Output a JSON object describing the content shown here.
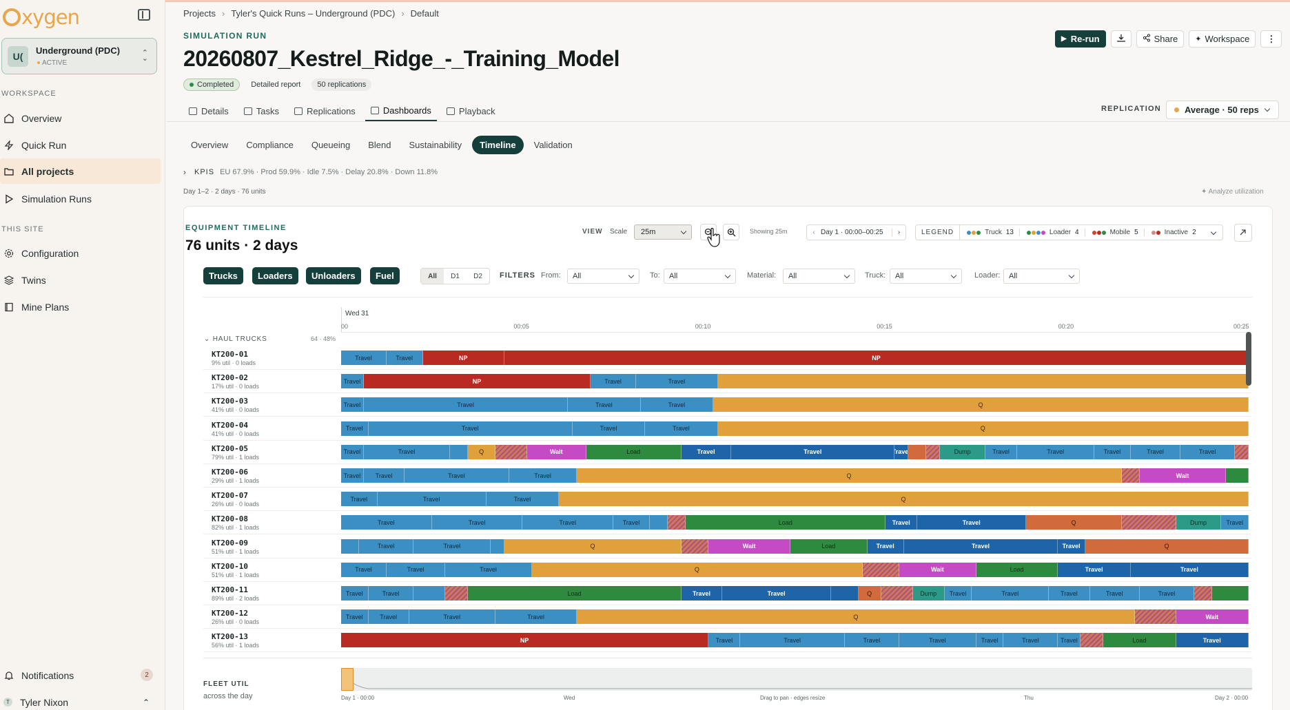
{
  "brand": "Oxygen",
  "site": {
    "avatar": "U(",
    "name": "Underground (PDC)",
    "status": "ACTIVE"
  },
  "sidebar": {
    "section_workspace": "WORKSPACE",
    "items": [
      {
        "label": "Overview",
        "icon": "home-icon"
      },
      {
        "label": "Quick Run",
        "icon": "bolt-icon"
      },
      {
        "label": "All projects",
        "icon": "folder-icon",
        "active": true
      },
      {
        "label": "Simulation Runs",
        "icon": "play-icon"
      }
    ],
    "section_site": "THIS SITE",
    "site_items": [
      {
        "label": "Configuration",
        "icon": "gear-icon"
      },
      {
        "label": "Twins",
        "icon": "layers-icon"
      },
      {
        "label": "Mine Plans",
        "icon": "book-icon"
      }
    ],
    "notifications_label": "Notifications",
    "notifications_count": "2",
    "user_initial": "T",
    "user_name": "Tyler Nixon"
  },
  "breadcrumb": [
    "Projects",
    "Tyler's Quick Runs – Underground (PDC)",
    "Default"
  ],
  "run": {
    "eyebrow": "SIMULATION RUN",
    "title": "20260807_Kestrel_Ridge_-_Training_Model",
    "status": "Completed",
    "report": "Detailed report",
    "replications": "50 replications"
  },
  "actions": {
    "rerun": "Re-run",
    "share": "Share",
    "workspace": "Workspace"
  },
  "tabs": [
    "Details",
    "Tasks",
    "Replications",
    "Dashboards",
    "Playback"
  ],
  "active_tab": "Dashboards",
  "replication": {
    "label": "REPLICATION",
    "value": "Average · 50 reps"
  },
  "subtabs": [
    "Overview",
    "Compliance",
    "Queueing",
    "Blend",
    "Sustainability",
    "Timeline",
    "Validation"
  ],
  "active_subtab": "Timeline",
  "kpis": {
    "label": "KPIS",
    "text": "EU 67.9% · Prod 59.9% · Idle 7.5% · Delay 20.8% · Down 11.8%"
  },
  "range_note": "Day 1–2 · 2 days · 76 units",
  "analyze": "Analyze utilization",
  "timeline": {
    "eyebrow": "EQUIPMENT TIMELINE",
    "title": "76 units · 2 days",
    "view_label": "VIEW",
    "scale_label": "Scale",
    "scale_value": "25m",
    "showing": "Showing 25m",
    "day_range": "Day 1 · 00:00–00:25",
    "legend_label": "LEGEND",
    "legend": [
      {
        "name": "Truck",
        "count": "13",
        "colors": [
          "#3b8fc2",
          "#e0a03b",
          "#2e8a3e"
        ]
      },
      {
        "name": "Loader",
        "count": "4",
        "colors": [
          "#2e8a3e",
          "#e0a03b",
          "#3b8fc2",
          "#c44bc4"
        ]
      },
      {
        "name": "Mobile",
        "count": "5",
        "colors": [
          "#c44b2b",
          "#b82a22",
          "#2e8a3e"
        ]
      },
      {
        "name": "Inactive",
        "count": "2",
        "colors": [
          "#d28a8a",
          "#b82a22"
        ]
      }
    ],
    "filter_pills": [
      "Trucks",
      "Loaders",
      "Unloaders",
      "Fuel"
    ],
    "day_segments": [
      "All",
      "D1",
      "D2"
    ],
    "filters_label": "FILTERS",
    "filters": [
      {
        "label": "From:",
        "value": "All"
      },
      {
        "label": "To:",
        "value": "All"
      },
      {
        "label": "Material:",
        "value": "All"
      },
      {
        "label": "Truck:",
        "value": "All"
      },
      {
        "label": "Loader:",
        "value": "All"
      }
    ],
    "axis_day": "Wed 31",
    "ticks": [
      "00",
      "00:05",
      "00:10",
      "00:15",
      "00:20",
      "00:25"
    ],
    "group_label": "HAUL TRUCKS",
    "group_util": "64 · 48%",
    "rows": [
      {
        "name": "KT200-01",
        "sub": "9% util · 0 loads",
        "segs": [
          [
            "travel",
            0,
            5,
            "Travel"
          ],
          [
            "travel",
            5,
            9,
            "Travel"
          ],
          [
            "np",
            9,
            18,
            "NP"
          ],
          [
            "np",
            18,
            100,
            "NP"
          ]
        ]
      },
      {
        "name": "KT200-02",
        "sub": "17% util · 0 loads",
        "segs": [
          [
            "travel",
            0,
            2.5,
            "Travel"
          ],
          [
            "np",
            2.5,
            27.5,
            "NP"
          ],
          [
            "travel",
            27.5,
            32.5,
            "Travel"
          ],
          [
            "travel",
            32.5,
            41.5,
            "Travel"
          ],
          [
            "q",
            41.5,
            100,
            ""
          ]
        ]
      },
      {
        "name": "KT200-03",
        "sub": "41% util · 0 loads",
        "segs": [
          [
            "travel",
            0,
            2.5,
            "Travel"
          ],
          [
            "travel",
            2.5,
            25,
            "Travel"
          ],
          [
            "travel",
            25,
            33,
            "Travel"
          ],
          [
            "travel",
            33,
            41,
            "Travel"
          ],
          [
            "q",
            41,
            100,
            "Q"
          ]
        ]
      },
      {
        "name": "KT200-04",
        "sub": "41% util · 0 loads",
        "segs": [
          [
            "travel",
            0,
            3,
            "Travel"
          ],
          [
            "travel",
            3,
            25.5,
            "Travel"
          ],
          [
            "travel",
            25.5,
            33.5,
            "Travel"
          ],
          [
            "travel",
            33.5,
            41.5,
            "Travel"
          ],
          [
            "q",
            41.5,
            100,
            "Q"
          ]
        ]
      },
      {
        "name": "KT200-05",
        "sub": "79% util · 1 loads",
        "segs": [
          [
            "travel",
            0,
            2.5,
            "Travel"
          ],
          [
            "travel",
            2.5,
            12,
            "Travel"
          ],
          [
            "travel",
            12,
            14,
            ""
          ],
          [
            "q",
            14,
            17,
            "Q"
          ],
          [
            "hatch",
            17,
            20.5,
            ""
          ],
          [
            "wait",
            20.5,
            27,
            "Wait"
          ],
          [
            "load",
            27,
            37.5,
            "Load"
          ],
          [
            "haul",
            37.5,
            43,
            "Travel"
          ],
          [
            "haul",
            43,
            61,
            "Travel"
          ],
          [
            "haul",
            61,
            62.5,
            "Travel"
          ],
          [
            "orange",
            62.5,
            64.5,
            ""
          ],
          [
            "hatch",
            64.5,
            66,
            ""
          ],
          [
            "dump",
            66,
            71,
            "Dump"
          ],
          [
            "travel",
            71,
            74.5,
            "Travel"
          ],
          [
            "travel",
            74.5,
            83,
            "Travel"
          ],
          [
            "travel",
            83,
            87,
            "Travel"
          ],
          [
            "travel",
            87,
            92.5,
            "Travel"
          ],
          [
            "travel",
            92.5,
            98.5,
            "Travel"
          ],
          [
            "hatch",
            98.5,
            100,
            ""
          ]
        ]
      },
      {
        "name": "KT200-06",
        "sub": "29% util · 1 loads",
        "segs": [
          [
            "travel",
            0,
            2.5,
            "Travel"
          ],
          [
            "travel",
            2.5,
            7,
            "Travel"
          ],
          [
            "travel",
            7,
            18.5,
            "Travel"
          ],
          [
            "travel",
            18.5,
            26,
            "Travel"
          ],
          [
            "q",
            26,
            86,
            "Q"
          ],
          [
            "hatch",
            86,
            88,
            ""
          ],
          [
            "wait",
            88,
            97.5,
            "Wait"
          ],
          [
            "load",
            97.5,
            100,
            ""
          ]
        ]
      },
      {
        "name": "KT200-07",
        "sub": "26% util · 0 loads",
        "segs": [
          [
            "travel",
            0,
            4,
            "Travel"
          ],
          [
            "travel",
            4,
            16,
            "Travel"
          ],
          [
            "travel",
            16,
            24,
            "Travel"
          ],
          [
            "q",
            24,
            100,
            "Q"
          ]
        ]
      },
      {
        "name": "KT200-08",
        "sub": "82% util · 1 loads",
        "segs": [
          [
            "travel",
            0,
            10,
            "Travel"
          ],
          [
            "travel",
            10,
            20,
            "Travel"
          ],
          [
            "travel",
            20,
            30,
            "Travel"
          ],
          [
            "travel",
            30,
            34,
            "Travel"
          ],
          [
            "travel",
            34,
            36,
            ""
          ],
          [
            "hatch",
            36,
            38,
            ""
          ],
          [
            "load",
            38,
            60,
            "Load"
          ],
          [
            "haul",
            60,
            63.5,
            "Travel"
          ],
          [
            "haul",
            63.5,
            75.5,
            "Travel"
          ],
          [
            "orange",
            75.5,
            86,
            "Q"
          ],
          [
            "hatch",
            86,
            92,
            ""
          ],
          [
            "dump",
            92,
            97,
            "Dump"
          ],
          [
            "travel",
            97,
            100,
            "Travel"
          ]
        ]
      },
      {
        "name": "KT200-09",
        "sub": "51% util · 1 loads",
        "segs": [
          [
            "travel",
            0,
            2,
            ""
          ],
          [
            "travel",
            2,
            8,
            "Travel"
          ],
          [
            "travel",
            8,
            16.5,
            "Travel"
          ],
          [
            "travel",
            16.5,
            18,
            ""
          ],
          [
            "q",
            18,
            37.5,
            "Q"
          ],
          [
            "hatch",
            37.5,
            40.5,
            ""
          ],
          [
            "wait",
            40.5,
            49.5,
            "Wait"
          ],
          [
            "load",
            49.5,
            58,
            "Load"
          ],
          [
            "haul",
            58,
            62,
            "Travel"
          ],
          [
            "haul",
            62,
            79,
            "Travel"
          ],
          [
            "haul",
            79,
            82,
            "Travel"
          ],
          [
            "orange",
            82,
            100,
            "Q"
          ]
        ]
      },
      {
        "name": "KT200-10",
        "sub": "51% util · 1 loads",
        "segs": [
          [
            "travel",
            0,
            5,
            "Travel"
          ],
          [
            "travel",
            5,
            11.5,
            "Travel"
          ],
          [
            "travel",
            11.5,
            21,
            "Travel"
          ],
          [
            "q",
            21,
            57.5,
            "Q"
          ],
          [
            "hatch",
            57.5,
            61.5,
            ""
          ],
          [
            "wait",
            61.5,
            70,
            "Wait"
          ],
          [
            "load",
            70,
            79,
            "Load"
          ],
          [
            "haul",
            79,
            87,
            "Travel"
          ],
          [
            "haul",
            87,
            100,
            "Travel"
          ]
        ]
      },
      {
        "name": "KT200-11",
        "sub": "89% util · 2 loads",
        "segs": [
          [
            "travel",
            0,
            3,
            "Travel"
          ],
          [
            "travel",
            3,
            8,
            "Travel"
          ],
          [
            "travel",
            8,
            11.5,
            ""
          ],
          [
            "hatch",
            11.5,
            14,
            ""
          ],
          [
            "load",
            14,
            37.5,
            "Load"
          ],
          [
            "haul",
            37.5,
            42,
            "Travel"
          ],
          [
            "haul",
            42,
            54,
            "Travel"
          ],
          [
            "haul",
            54,
            57,
            ""
          ],
          [
            "orange",
            57,
            59.5,
            "Q"
          ],
          [
            "hatch",
            59.5,
            63,
            ""
          ],
          [
            "dump",
            63,
            66.5,
            "Dump"
          ],
          [
            "travel",
            66.5,
            69.5,
            "Travel"
          ],
          [
            "travel",
            69.5,
            78,
            "Travel"
          ],
          [
            "travel",
            78,
            82.5,
            "Travel"
          ],
          [
            "travel",
            82.5,
            88,
            "Travel"
          ],
          [
            "travel",
            88,
            94,
            "Travel"
          ],
          [
            "hatch",
            94,
            96,
            ""
          ],
          [
            "load",
            96,
            100,
            ""
          ]
        ]
      },
      {
        "name": "KT200-12",
        "sub": "26% util · 0 loads",
        "segs": [
          [
            "travel",
            0,
            3,
            "Travel"
          ],
          [
            "travel",
            3,
            7.5,
            "Travel"
          ],
          [
            "travel",
            7.5,
            17,
            "Travel"
          ],
          [
            "travel",
            17,
            26,
            "Travel"
          ],
          [
            "q",
            26,
            87.5,
            "Q"
          ],
          [
            "hatch",
            87.5,
            92,
            ""
          ],
          [
            "wait",
            92,
            100,
            "Wait"
          ]
        ]
      },
      {
        "name": "KT200-13",
        "sub": "56% util · 1 loads",
        "segs": [
          [
            "np",
            0,
            40.5,
            "NP"
          ],
          [
            "travel",
            40.5,
            44,
            "Travel"
          ],
          [
            "travel",
            44,
            55.5,
            "Travel"
          ],
          [
            "travel",
            55.5,
            61.5,
            "Travel"
          ],
          [
            "travel",
            61.5,
            70,
            "Travel"
          ],
          [
            "travel",
            70,
            73,
            "Travel"
          ],
          [
            "travel",
            73,
            79,
            "Travel"
          ],
          [
            "travel",
            79,
            81.5,
            "Travel"
          ],
          [
            "hatch",
            81.5,
            84,
            ""
          ],
          [
            "load",
            84,
            92,
            "Load"
          ],
          [
            "haul",
            92,
            100,
            "Travel"
          ]
        ]
      }
    ],
    "fleet_label": "FLEET UTIL",
    "fleet_sub": "across the day",
    "fleet_ticks": [
      "Day 1 · 00:00",
      "Wed",
      "Drag to pan · edges resize",
      "Thu",
      "Day 2 · 00:00"
    ]
  },
  "colors": {
    "travel": "#3b8fc2",
    "np": "#b82a22",
    "q": "#e0a03b",
    "wait": "#c44bc4",
    "load": "#2e8a3e",
    "haul": "#1d64a8",
    "orange": "#d26b3c",
    "dump": "#2c9a86",
    "brand_dark": "#153f3a"
  }
}
